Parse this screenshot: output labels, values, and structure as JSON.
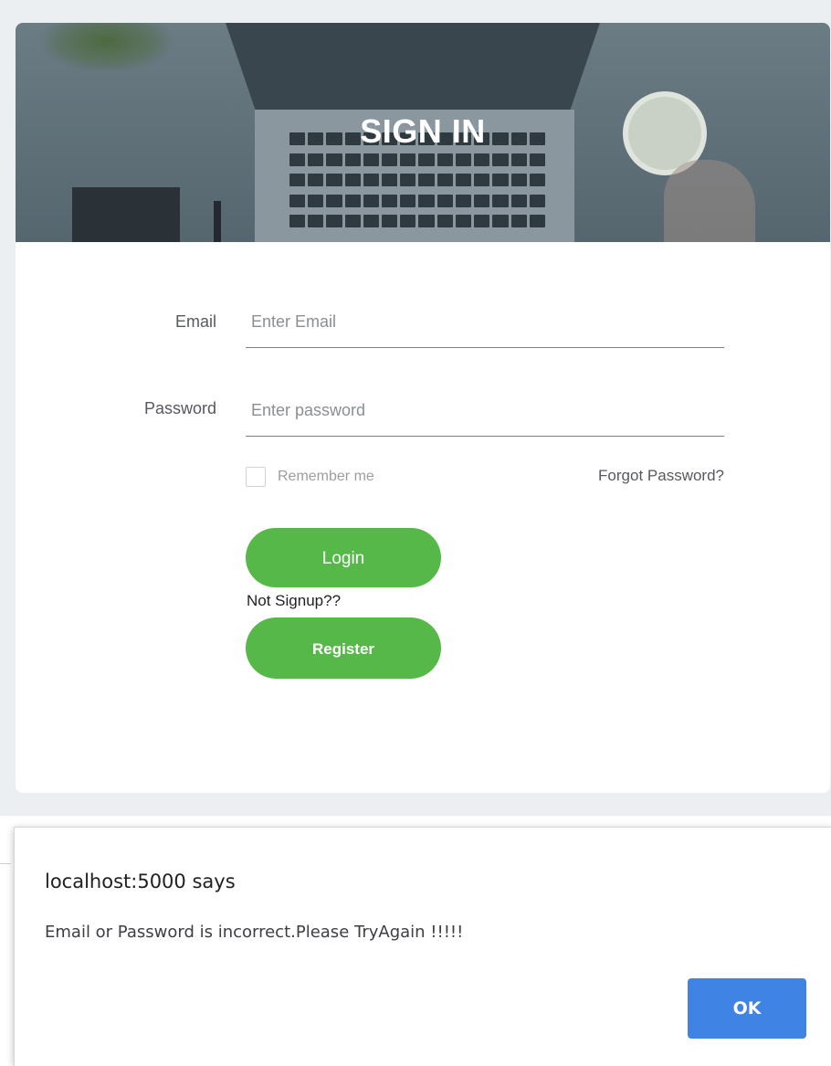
{
  "signin": {
    "title": "SIGN IN",
    "email": {
      "label": "Email",
      "placeholder": "Enter Email",
      "value": ""
    },
    "password": {
      "label": "Password",
      "placeholder": "Enter password",
      "value": ""
    },
    "remember_label": "Remember me",
    "remember_checked": false,
    "forgot_label": "Forgot Password?",
    "login_label": "Login",
    "not_signup_text": "Not Signup??",
    "register_label": "Register",
    "accent_color": "#57b84a"
  },
  "alert": {
    "title": "localhost:5000 says",
    "message": "Email or Password is incorrect.Please TryAgain !!!!!",
    "ok_label": "OK",
    "ok_color": "#3f84e5"
  }
}
